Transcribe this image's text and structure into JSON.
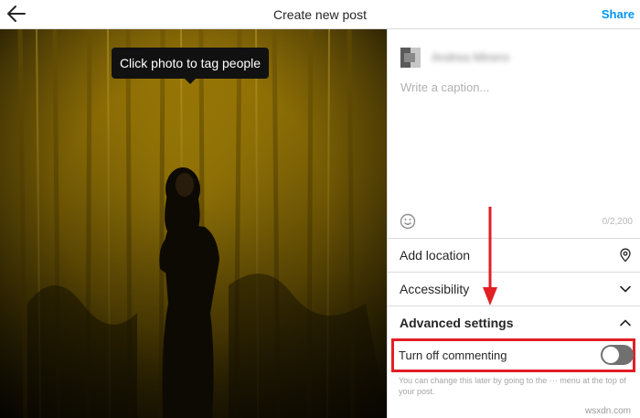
{
  "header": {
    "back_icon": "arrow-left-icon",
    "title": "Create new post",
    "share_label": "Share",
    "accent_color": "#0095f6"
  },
  "photo": {
    "tooltip": "Click photo to tag people"
  },
  "panel": {
    "username": "Andrea Minero",
    "caption_placeholder": "Write a caption...",
    "emoji_icon": "smiley-icon",
    "char_count": "0/2,200",
    "rows": [
      {
        "label": "Add location",
        "icon": "location-pin-icon"
      },
      {
        "label": "Accessibility",
        "icon": "chevron-down-icon"
      },
      {
        "label": "Advanced settings",
        "icon": "chevron-up-icon"
      }
    ],
    "commenting": {
      "label": "Turn off commenting",
      "enabled": false,
      "helper": "You can change this later by going to the ··· menu at the top of your post."
    }
  },
  "annotation": {
    "highlight_color": "#e31e25"
  },
  "watermark": "wsxdn.com"
}
